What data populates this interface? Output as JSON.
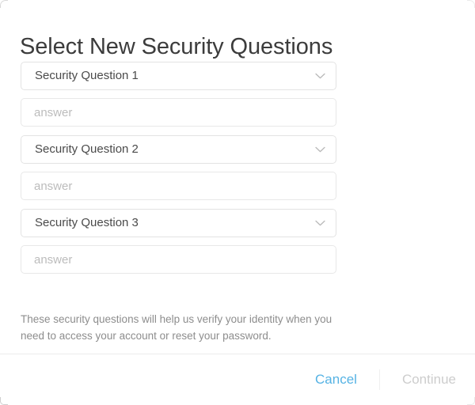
{
  "dialog": {
    "title": "Select New Security Questions",
    "help_text": "These security questions will help us verify your identity when you need to access your account or reset your password."
  },
  "questions": [
    {
      "select_label": "Security Question 1",
      "answer_value": "",
      "answer_placeholder": "answer",
      "chevron_icon": "chevron-down-icon"
    },
    {
      "select_label": "Security Question 2",
      "answer_value": "",
      "answer_placeholder": "answer",
      "chevron_icon": "chevron-down-icon"
    },
    {
      "select_label": "Security Question 3",
      "answer_value": "",
      "answer_placeholder": "answer",
      "chevron_icon": "chevron-down-icon"
    }
  ],
  "footer": {
    "cancel_label": "Cancel",
    "continue_label": "Continue"
  },
  "colors": {
    "cancel_accent": "#56b3e4",
    "continue_disabled": "#cdcdcd",
    "title": "#3c3c3c",
    "help_text": "#8d8d8d",
    "field_border": "#e3e3e3",
    "placeholder": "#bcbcbc",
    "divider": "#ececec",
    "background": "#ffffff"
  }
}
